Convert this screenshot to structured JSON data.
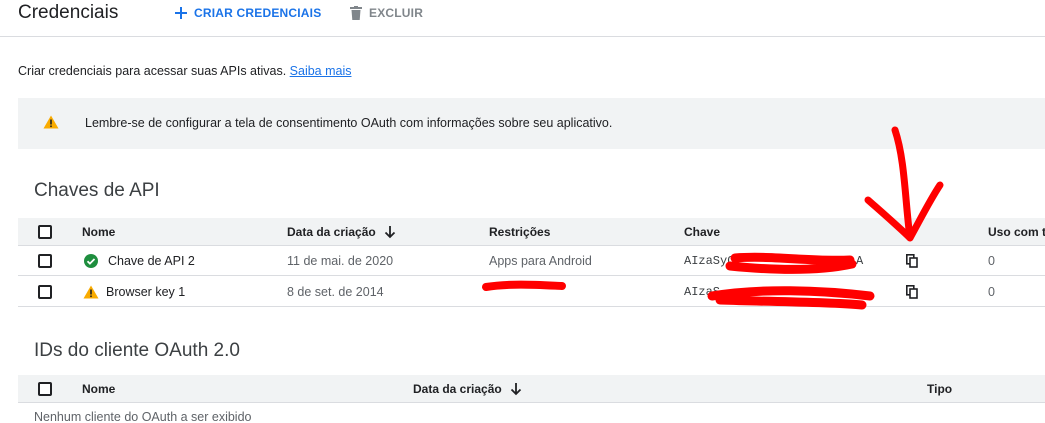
{
  "header": {
    "title": "Credenciais",
    "create_label": "CRIAR CREDENCIAIS",
    "delete_label": "EXCLUIR"
  },
  "intro": {
    "text": "Criar credenciais para acessar suas APIs ativas.",
    "link": "Saiba mais"
  },
  "banner": {
    "text": "Lembre-se de configurar a tela de consentimento OAuth com informações sobre seu aplicativo."
  },
  "api_keys": {
    "title": "Chaves de API",
    "columns": {
      "name": "Nome",
      "created": "Data da criação",
      "restrictions": "Restrições",
      "key": "Chave",
      "usage": "Uso com to"
    },
    "rows": [
      {
        "name": "Chave de API 2",
        "status": "ok",
        "created": "11 de mai. de 2020",
        "restrictions": "Apps para Android",
        "key": "AIzaSyC",
        "key_end": "A",
        "usage": "0"
      },
      {
        "name": "Browser key 1",
        "status": "warning",
        "created": "8 de set. de 2014",
        "restrictions": "",
        "key": "AIzaS",
        "key_end": "",
        "usage": "0"
      }
    ]
  },
  "oauth": {
    "title": "IDs do cliente OAuth 2.0",
    "columns": {
      "name": "Nome",
      "created": "Data da criação",
      "type": "Tipo"
    },
    "empty": "Nenhum cliente do OAuth a ser exibido"
  },
  "colors": {
    "accent": "#1a73e8",
    "ok": "#1e8e3e",
    "warning": "#f9ab00",
    "annotation": "#ff0000"
  }
}
